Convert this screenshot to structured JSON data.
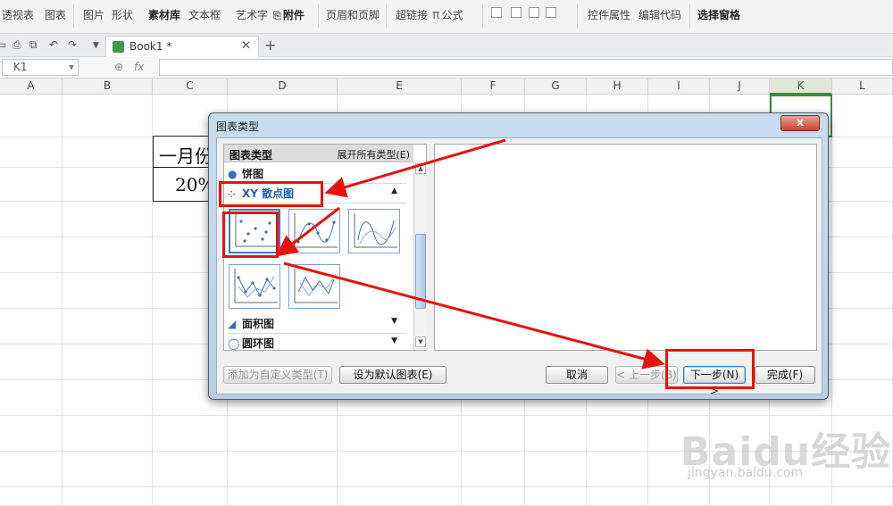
{
  "ribbon": {
    "items": [
      {
        "label": "透视表"
      },
      {
        "label": "图表"
      },
      {
        "label": "图片"
      },
      {
        "label": "形状"
      },
      {
        "label": "素材库"
      },
      {
        "label": "文本框"
      },
      {
        "label": "艺术字"
      },
      {
        "label": "附件"
      },
      {
        "label": "页眉和页脚"
      },
      {
        "label": "超链接"
      },
      {
        "label": "公式"
      },
      {
        "label": "控件属性"
      },
      {
        "label": "编辑代码"
      },
      {
        "label": "选择窗格"
      }
    ]
  },
  "tabs": {
    "doc_tab": "Book1 *",
    "close": "✕",
    "new_tab": "+"
  },
  "formula_bar": {
    "name_box": "K1",
    "fx": "fx"
  },
  "columns": [
    "A",
    "B",
    "C",
    "D",
    "E",
    "F",
    "G",
    "H",
    "I",
    "J",
    "K",
    "L"
  ],
  "sheet": {
    "cell_month": "一月份",
    "cell_value": "20%"
  },
  "dialog": {
    "title": "图表类型",
    "close": "x",
    "list_header": "图表类型",
    "expand_all": "展开所有类型(E)",
    "categories": [
      {
        "label": "饼图",
        "icon": "pie-chart-icon"
      },
      {
        "label": "XY 散点图",
        "icon": "scatter-chart-icon"
      },
      {
        "label": "面积图",
        "icon": "area-chart-icon"
      },
      {
        "label": "圆环图",
        "icon": "doughnut-chart-icon"
      }
    ],
    "buttons": {
      "add_custom": "添加为自定义类型(T)",
      "set_default": "设为默认图表(E)",
      "cancel": "取消",
      "prev": "< 上一步(B)",
      "next": "下一步(N) >",
      "finish": "完成(F)"
    }
  },
  "watermark": {
    "brand": "Baidu经验",
    "url": "jingyan.baidu.com"
  },
  "colors": {
    "annotation_red": "#e8110c",
    "selection_green": "#3e8a3e",
    "dialog_frame": "#b9cfe6"
  }
}
